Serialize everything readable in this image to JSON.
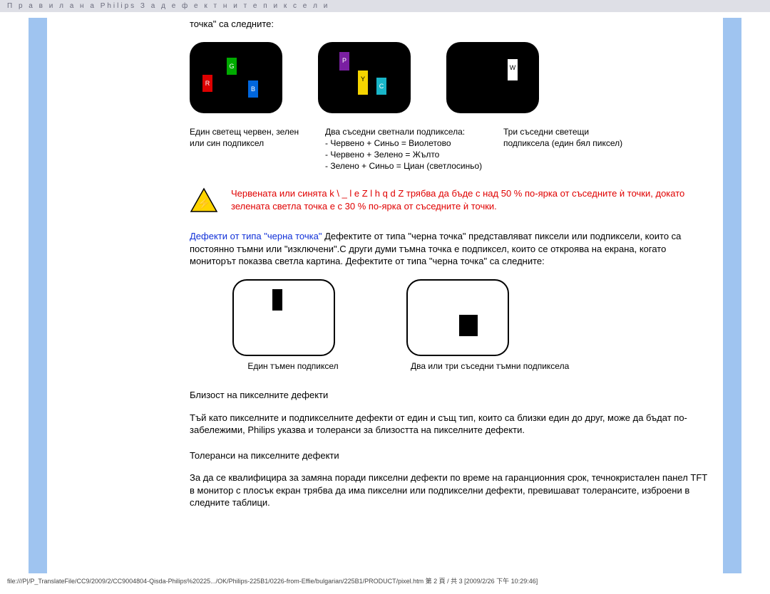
{
  "header": "П р а в и л а   н а   Philips   З а   д е ф е к т н и т е   п и к с е л и",
  "intro_tail": "точка\" са следните:",
  "tile1": {
    "r": "R",
    "g": "G",
    "b": "B"
  },
  "tile2": {
    "p": "P",
    "y": "Y",
    "c": "C"
  },
  "tile3": {
    "w": "W"
  },
  "cap1": "Един светещ червен, зелен или син подпиксел",
  "cap2": "Два съседни светнали подпиксела:\n- Червено + Синьо = Виолетово\n- Червено + Зелено = Жълто\n- Зелено + Синьо = Циан (светлосиньо)",
  "cap3": "Три съседни светещи подпиксела (един бял пиксел)",
  "warning": "Червената или синята  k \\ _ l e Z  l h q d Z трябва да бъде с над 50 % по-ярка от съседните ѝ точки, докато зелената светла точка е с 30 % по-ярка от съседните ѝ точки.",
  "black_dot_heading": "Дефекти от типа \"черна точка\"",
  "black_dot_body": " Дефектите от типа \"черна точка\" представляват пиксели или подпиксели, които са постоянно тъмни или \"изключени\".С други думи тъмна точка е подпиксел, които се откроява на екрана, когато мониторът показва светла картина. Дефектите от типа \"черна точка\" са следните:",
  "dark_cap1": "Един тъмен подпиксел",
  "dark_cap2": "Два или три съседни тъмни подпиксела",
  "h_proximity": "Близост на пикселните дефекти",
  "p_proximity": "Тъй като пикселните и подпикселните дефекти от един и същ тип, които са близки един до друг, може да бъдат по-забележими, Philips указва и толеранси за близостта на пикселните дефекти.",
  "h_tolerance": "Толеранси на пикселните дефекти",
  "p_tolerance": "За да се квалифицира за замяна поради пикселни дефекти по време на гаранционния срок, течнокристален панел TFT в монитор с плосък екран трябва да има пикселни или подпикселни дефекти, превишават толерансите, изброени в следните таблици.",
  "footer": "file:///P|/P_TranslateFile/CC9/2009/2/CC9004804-Qisda-Philips%20225.../OK/Philips-225B1/0226-from-Effie/bulgarian/225B1/PRODUCT/pixel.htm 第 2 頁 / 共 3  [2009/2/26 下午 10:29:46]"
}
